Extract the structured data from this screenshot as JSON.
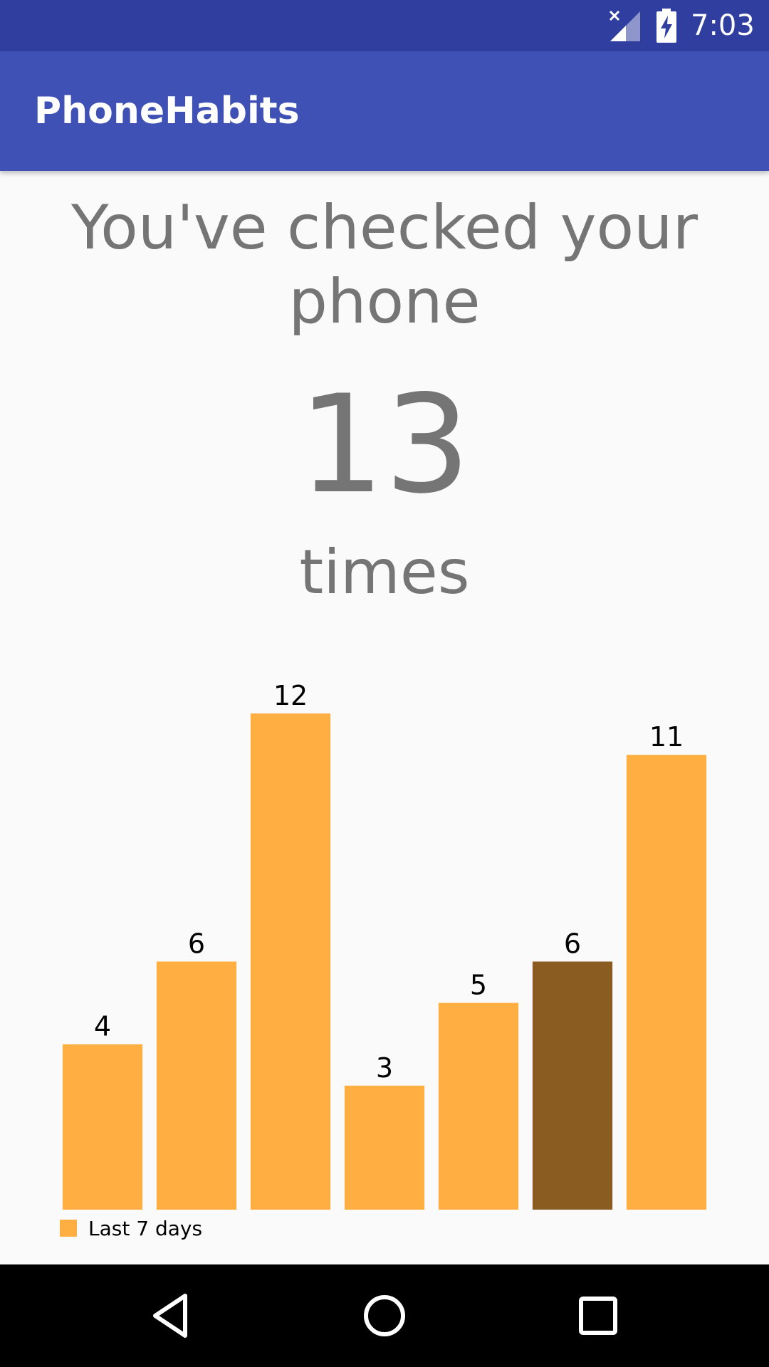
{
  "status_bar": {
    "time": "7:03",
    "icons": [
      "signal-no-service-icon",
      "battery-charging-icon"
    ],
    "background": "#303f9f"
  },
  "app_bar": {
    "title": "PhoneHabits",
    "background": "#3f51b5"
  },
  "main": {
    "headline": "You've checked your phone",
    "count": "13",
    "unit": "times",
    "text_color": "#757575"
  },
  "chart_data": {
    "type": "bar",
    "categories": [
      "",
      "",
      "",
      "",
      "",
      "",
      ""
    ],
    "series": [
      {
        "name": "Last 7 days",
        "values": [
          4,
          6,
          12,
          3,
          5,
          6,
          11
        ]
      }
    ],
    "highlighted_index": 5,
    "colors": {
      "bar": "#ffae42",
      "highlighted_bar": "#8a5c22"
    },
    "ylim": [
      0,
      13
    ],
    "legend": "bottom-left",
    "grid": false,
    "data_labels": true
  },
  "nav_bar": {
    "buttons": [
      "back-icon",
      "home-icon",
      "recents-icon"
    ]
  }
}
